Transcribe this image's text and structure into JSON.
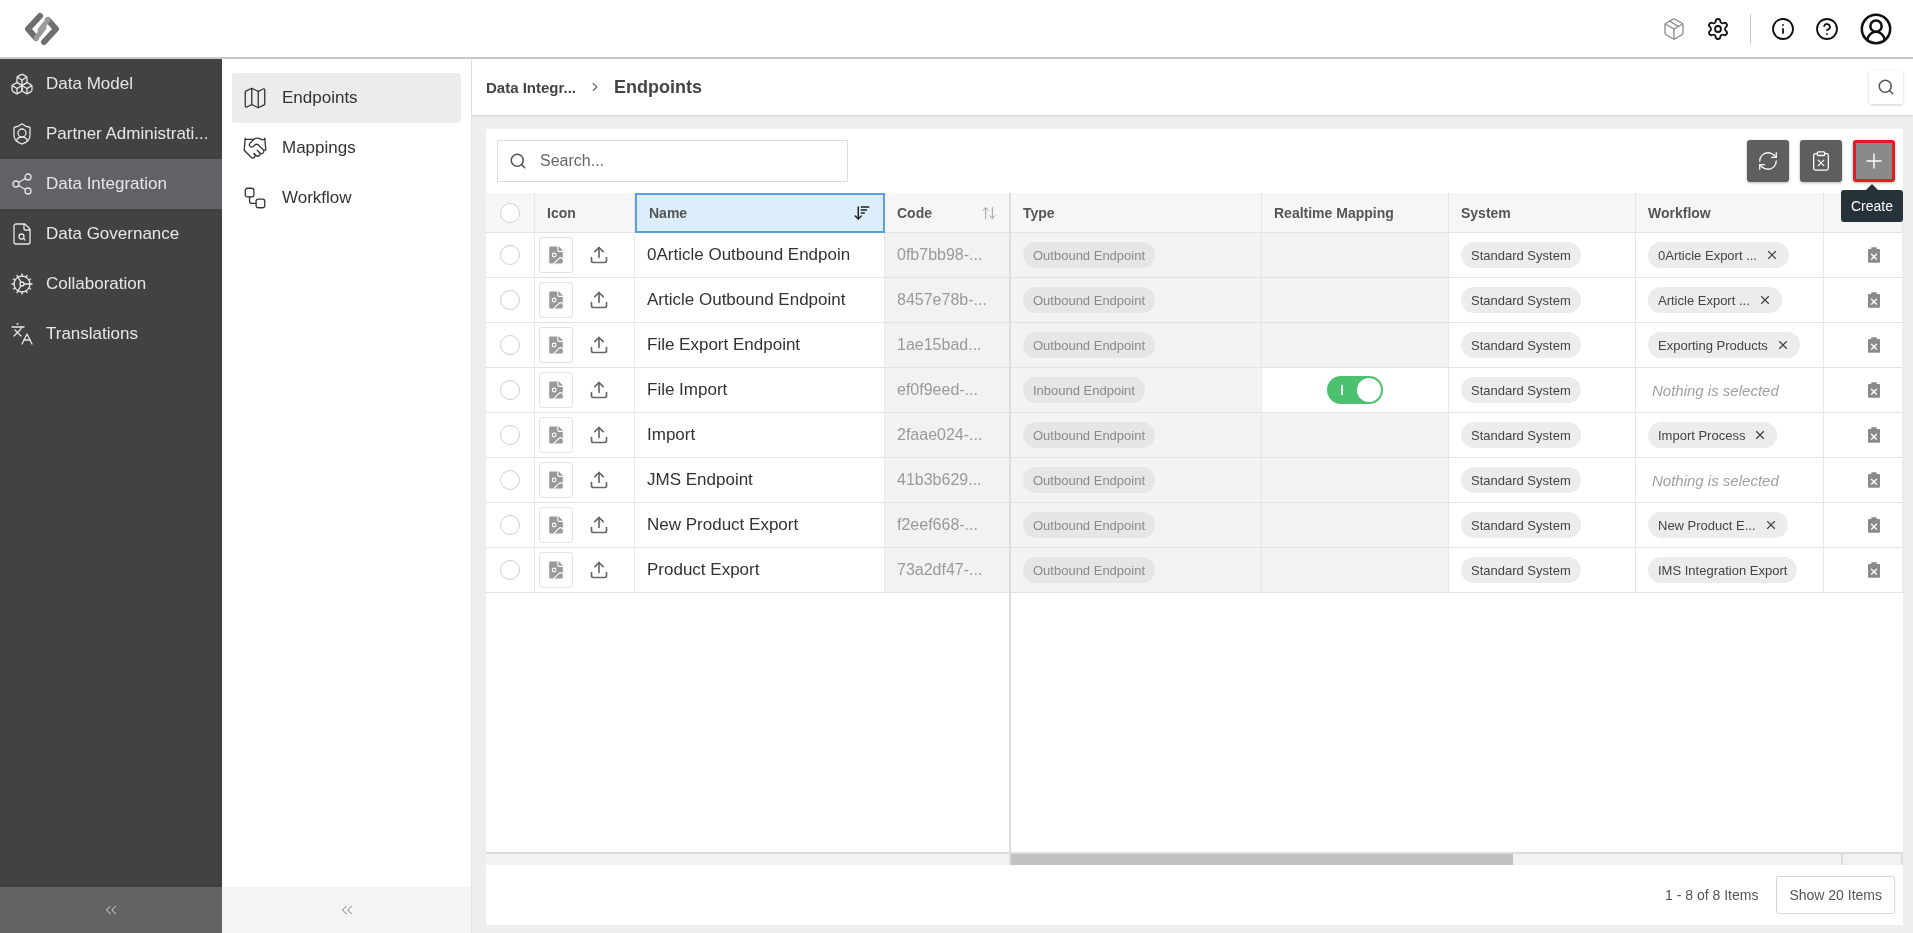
{
  "nav": [
    {
      "label": "Data Model",
      "selected": false
    },
    {
      "label": "Partner Administrati...",
      "selected": false
    },
    {
      "label": "Data Integration",
      "selected": true
    },
    {
      "label": "Data Governance",
      "selected": false
    },
    {
      "label": "Collaboration",
      "selected": false
    },
    {
      "label": "Translations",
      "selected": false
    }
  ],
  "subnav": [
    {
      "label": "Endpoints",
      "selected": true
    },
    {
      "label": "Mappings",
      "selected": false
    },
    {
      "label": "Workflow",
      "selected": false
    }
  ],
  "breadcrumb": [
    "Data Integr...",
    "Endpoints"
  ],
  "search": {
    "placeholder": "Search..."
  },
  "toolbar": [
    {
      "kind": "sync",
      "highlighted": false
    },
    {
      "kind": "delete",
      "highlighted": false
    },
    {
      "kind": "create",
      "highlighted": true,
      "tooltip": "Create"
    }
  ],
  "table": {
    "all_selected": false,
    "columns": [
      {
        "label": "Icon",
        "sorted": false,
        "sortable": false,
        "selected": false
      },
      {
        "label": "Name",
        "sorted": true,
        "selected": true
      },
      {
        "label": "Code",
        "sorted": false,
        "sortable": true,
        "selected": false
      },
      {
        "label": "Type",
        "sorted": false,
        "sortable": false,
        "selected": false
      },
      {
        "label": "Realtime Mapping",
        "sorted": false,
        "sortable": false,
        "selected": false
      },
      {
        "label": "System",
        "sorted": false,
        "sortable": false,
        "selected": false
      },
      {
        "label": "Workflow",
        "sorted": false,
        "sortable": false,
        "selected": false
      }
    ],
    "rows": [
      {
        "selected": false,
        "name": "0Article Outbound Endpoin",
        "code": "0fb7bb98-...",
        "type": "Outbound Endpoint",
        "realtime": false,
        "system": "Standard System",
        "workflow": {
          "kind": "chip",
          "text": "0Article Export ...",
          "removable": true
        }
      },
      {
        "selected": false,
        "name": "Article Outbound Endpoint",
        "code": "8457e78b-...",
        "type": "Outbound Endpoint",
        "realtime": false,
        "system": "Standard System",
        "workflow": {
          "kind": "chip",
          "text": "Article Export ...",
          "removable": true
        }
      },
      {
        "selected": false,
        "name": "File Export Endpoint",
        "code": "1ae15bad...",
        "type": "Outbound Endpoint",
        "realtime": false,
        "system": "Standard System",
        "workflow": {
          "kind": "chip",
          "text": "Exporting Products",
          "removable": true
        }
      },
      {
        "selected": false,
        "name": "File Import",
        "code": "ef0f9eed-...",
        "type": "Inbound Endpoint",
        "realtime": true,
        "system": "Standard System",
        "workflow": {
          "kind": "empty",
          "text": "Nothing is selected"
        }
      },
      {
        "selected": false,
        "name": "Import",
        "code": "2faae024-...",
        "type": "Outbound Endpoint",
        "realtime": false,
        "system": "Standard System",
        "workflow": {
          "kind": "chip",
          "text": "Import Process",
          "removable": true
        }
      },
      {
        "selected": false,
        "name": "JMS Endpoint",
        "code": "41b3b629...",
        "type": "Outbound Endpoint",
        "realtime": false,
        "system": "Standard System",
        "workflow": {
          "kind": "empty",
          "text": "Nothing is selected"
        }
      },
      {
        "selected": false,
        "name": "New Product Export",
        "code": "f2eef668-...",
        "type": "Outbound Endpoint",
        "realtime": false,
        "system": "Standard System",
        "workflow": {
          "kind": "chip",
          "text": "New Product E...",
          "removable": true
        }
      },
      {
        "selected": false,
        "name": "Product Export",
        "code": "73a2df47-...",
        "type": "Outbound Endpoint",
        "realtime": false,
        "system": "Standard System",
        "workflow": {
          "kind": "chip",
          "text": "IMS Integration Export",
          "removable": false
        }
      }
    ]
  },
  "footer": {
    "count": "1 - 8 of 8 Items",
    "page_size": "Show 20 Items"
  }
}
